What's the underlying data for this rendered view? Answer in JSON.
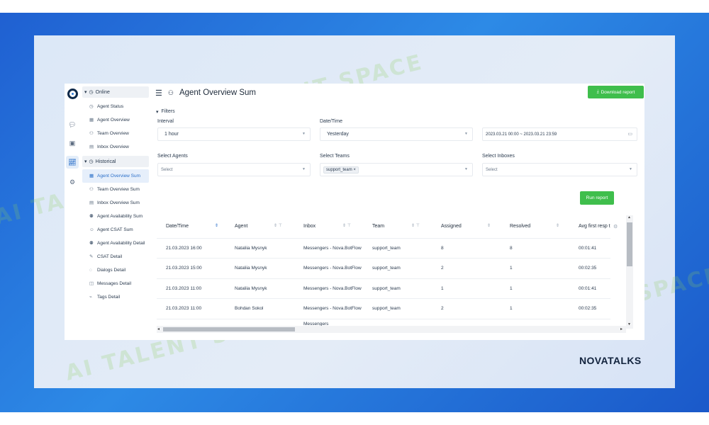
{
  "watermark": "AI TALENT SPACE",
  "brand": "NOVATALKS",
  "colors": {
    "accent": "#3fbe4c",
    "active": "#2a6fc9",
    "dark": "#1d2a3a"
  },
  "rail": {
    "icons": [
      "logo-icon",
      "chat-icon",
      "contacts-icon",
      "reports-icon",
      "settings-icon"
    ]
  },
  "sidebar": {
    "online": {
      "label": "Online",
      "items": [
        {
          "label": "Agent Status",
          "icon": "clock-icon"
        },
        {
          "label": "Agent Overview",
          "icon": "grid-icon"
        },
        {
          "label": "Team Overview",
          "icon": "team-icon"
        },
        {
          "label": "Inbox Overview",
          "icon": "inbox-icon"
        }
      ]
    },
    "historical": {
      "label": "Historical",
      "items": [
        {
          "label": "Agent Overview Sum",
          "icon": "grid-icon",
          "active": true
        },
        {
          "label": "Team Overview Sum",
          "icon": "team-icon"
        },
        {
          "label": "Inbox Overview Sum",
          "icon": "inbox-icon"
        },
        {
          "label": "Agent Availability Sum",
          "icon": "person-icon"
        },
        {
          "label": "Agent CSAT Sum",
          "icon": "smile-icon"
        },
        {
          "label": "Agent Availability Detail",
          "icon": "person-icon"
        },
        {
          "label": "CSAT Detail",
          "icon": "csat-icon"
        },
        {
          "label": "Dialogs Detail",
          "icon": "dialog-icon"
        },
        {
          "label": "Messages Detail",
          "icon": "message-icon"
        },
        {
          "label": "Tags Detail",
          "icon": "tag-icon"
        }
      ]
    }
  },
  "header": {
    "title": "Agent Overview Sum",
    "download_label": "Download report"
  },
  "filters": {
    "label": "Filters",
    "interval_label": "Interval",
    "interval_value": "1 hour",
    "datetime_label": "Date/Time",
    "datetime_value": "Yesterday",
    "range_value": "2023.03.21 00:00 ~ 2023.03.21 23:59",
    "agents_label": "Select Agents",
    "agents_placeholder": "Select",
    "teams_label": "Select Teams",
    "teams_chip": "support_team",
    "inboxes_label": "Select Inboxes",
    "inboxes_placeholder": "Select",
    "run_label": "Run report"
  },
  "table": {
    "columns": [
      "Date/Time",
      "Agent",
      "Inbox",
      "Team",
      "Assigned",
      "Resolved",
      "Avg first resp time"
    ],
    "rows": [
      [
        "21.03.2023 16:00",
        "Nataliia Mysnyk",
        "Messengers - Nova.BotFlow",
        "support_team",
        "8",
        "8",
        "00:01:41"
      ],
      [
        "21.03.2023 15:00",
        "Nataliia Mysnyk",
        "Messengers - Nova.BotFlow",
        "support_team",
        "2",
        "1",
        "00:02:35"
      ],
      [
        "21.03.2023 11:00",
        "Nataliia Mysnyk",
        "Messengers - Nova.BotFlow",
        "support_team",
        "1",
        "1",
        "00:01:41"
      ],
      [
        "21.03.2023 11:00",
        "Bohdan Sokol",
        "Messengers - Nova.BotFlow",
        "support_team",
        "2",
        "1",
        "00:02:35"
      ],
      [
        "",
        "",
        "Messengers",
        "",
        "",
        "",
        ""
      ]
    ]
  }
}
